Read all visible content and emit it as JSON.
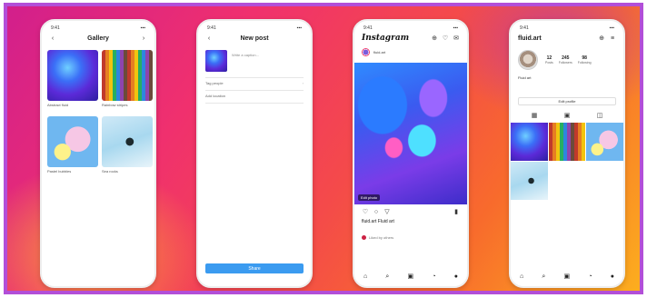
{
  "phones": {
    "gallery": {
      "title": "Gallery",
      "tiles": [
        {
          "caption": "Abstract fluid"
        },
        {
          "caption": "Rainbow stripes"
        },
        {
          "caption": "Pastel bubbles"
        },
        {
          "caption": "Sea rocks"
        }
      ]
    },
    "compose": {
      "title": "New post",
      "post_text": "Write a caption...",
      "tag_people": "Tag people",
      "add_location": "Add location",
      "share_label": "Share"
    },
    "feed": {
      "logo": "Instagram",
      "username": "fluid.art",
      "tag_label": "Edit photo",
      "caption": "fluid.art Fluid art",
      "likes": "Liked by others"
    },
    "profile": {
      "username": "fluid.art",
      "stats": [
        {
          "num": "12",
          "label": "Posts"
        },
        {
          "num": "245",
          "label": "Followers"
        },
        {
          "num": "98",
          "label": "Following"
        }
      ],
      "bio": "Fluid art",
      "edit_label": "Edit profile"
    }
  },
  "colors": {
    "banner_border": "#b24fd8",
    "accent_blue": "#3b9bf0"
  },
  "icons": [
    "back-arrow-icon",
    "plus-icon",
    "heart-icon",
    "messenger-icon",
    "comment-icon",
    "share-icon",
    "bookmark-icon",
    "home-icon",
    "search-icon",
    "reels-icon",
    "shop-icon",
    "menu-icon",
    "grid-icon"
  ]
}
